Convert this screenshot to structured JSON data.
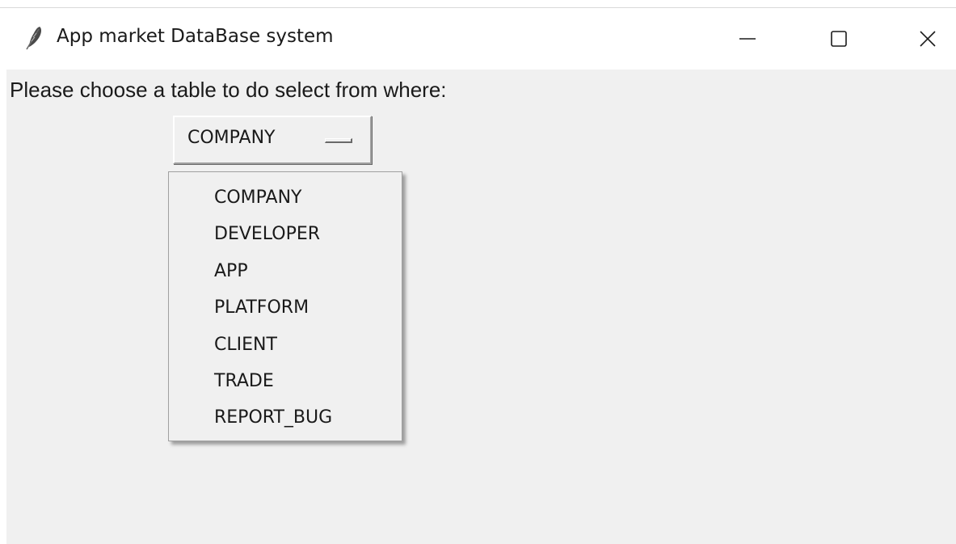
{
  "window": {
    "title": "App market DataBase system",
    "app_icon": "feather-icon",
    "controls": {
      "minimize_icon": "minimize-icon",
      "maximize_icon": "maximize-icon",
      "close_icon": "close-icon"
    }
  },
  "main": {
    "prompt": "Please choose a table to do select from where:",
    "table_select": {
      "selected": "COMPANY",
      "options": [
        "COMPANY",
        "DEVELOPER",
        "APP",
        "PLATFORM",
        "CLIENT",
        "TRADE",
        "REPORT_BUG"
      ]
    }
  },
  "colors": {
    "client_background": "#f0f0f0",
    "titlebar_background": "#ffffff",
    "text": "#1a1a1a"
  }
}
